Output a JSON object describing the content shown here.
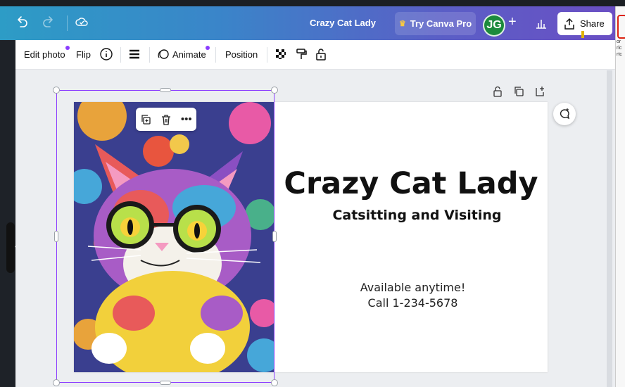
{
  "header": {
    "doc_title": "Crazy Cat Lady",
    "try_pro_label": "Try Canva Pro",
    "avatar_initials": "JG",
    "add_user_symbol": "+",
    "share_label": "Share",
    "icons": [
      "undo-icon",
      "redo-icon",
      "cloud-saved-icon",
      "crown-icon",
      "analytics-icon",
      "share-upload-icon"
    ]
  },
  "toolbar": {
    "edit_photo_label": "Edit photo",
    "flip_label": "Flip",
    "animate_label": "Animate",
    "position_label": "Position",
    "icons": [
      "info-icon",
      "line-spacing-icon",
      "animate-icon",
      "transparency-icon",
      "style-paint-roller-icon",
      "lock-icon"
    ]
  },
  "canvas": {
    "page_icons": [
      "lock-icon",
      "duplicate-page-icon",
      "add-page-icon"
    ],
    "float_menu_icons": [
      "duplicate-icon",
      "delete-icon",
      "more-icon"
    ],
    "float_more_label": "•••",
    "design": {
      "title": "Crazy Cat Lady",
      "subtitle": "Catsitting and Visiting",
      "availability": "Available anytime!",
      "phone": "Call 1-234-5678"
    },
    "comment_icon": "add-comment-icon"
  },
  "right_edge_text": "or\nrlc\nrtc",
  "colors": {
    "accent": "#8b3dff",
    "avatar_bg": "#1c8a3c",
    "crown": "#f7c843"
  }
}
